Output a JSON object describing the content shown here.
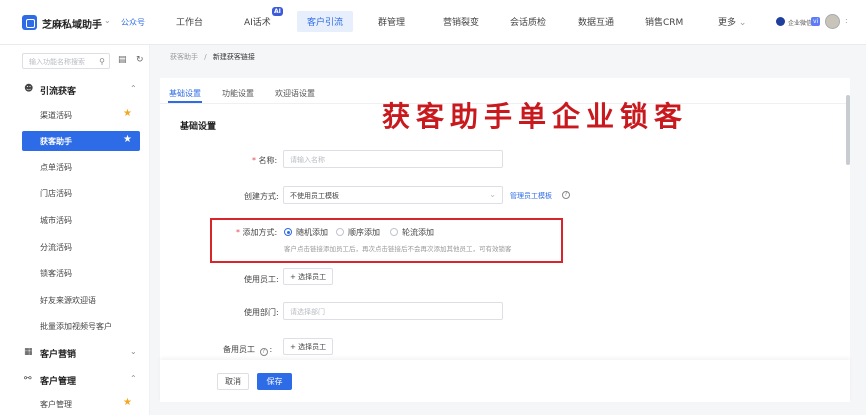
{
  "header": {
    "app_name": "芝麻私域助手",
    "app_sub": "公众号",
    "nav": [
      "工作台",
      "AI话术",
      "客户引流",
      "群管理",
      "营销裂变",
      "会话质检",
      "数据互通",
      "销售CRM",
      "更多"
    ],
    "nav_active": "客户引流",
    "ai_badge": "AI",
    "more_caret": "⌄",
    "user_name": "企业微信",
    "user_tag": "vi",
    "user_more": ":",
    "app_caret": "⌄"
  },
  "sidebar": {
    "search_placeholder": "输入功能名称搜索",
    "groups": [
      {
        "title": "引流获客",
        "icon": "person-plus-icon",
        "items": [
          "渠道活码",
          "获客助手",
          "点单活码",
          "门店活码",
          "城市活码",
          "分流活码",
          "锁客活码",
          "好友来源欢迎语",
          "批量添加视频号客户"
        ]
      },
      {
        "title": "客户营销",
        "icon": "calendar-icon"
      },
      {
        "title": "客户管理",
        "icon": "people-icon",
        "items": [
          "客户管理"
        ]
      }
    ],
    "active_item": "获客助手"
  },
  "breadcrumb": {
    "parent": "获客助手",
    "sep": "/",
    "current": "新建获客链接"
  },
  "tabs": [
    "基础设置",
    "功能设置",
    "欢迎语设置"
  ],
  "banner": "获客助手单企业锁客",
  "section_title": "基础设置",
  "form": {
    "name_label": "名称:",
    "name_placeholder": "请输入名称",
    "create_label": "创建方式:",
    "create_value": "不使用员工模板",
    "create_link": "管理员工模板",
    "add_label": "添加方式:",
    "add_options": [
      "随机添加",
      "顺序添加",
      "轮流添加"
    ],
    "add_selected": 0,
    "add_hint": "客户点击链接添加员工后，再次点击链接后不会再次添加其他员工，可有效锁客",
    "staff_label": "使用员工:",
    "staff_button": "+ 选择员工",
    "dept_label": "使用部门:",
    "dept_placeholder": "请选择部门",
    "backup_label": "备用员工",
    "backup_button": "+ 选择员工"
  },
  "footer": {
    "cancel": "取消",
    "save": "保存"
  },
  "colors": {
    "primary": "#2e6be6",
    "banner": "#c8191e",
    "highlight_box": "#d7262b",
    "star": "#f5a623"
  }
}
